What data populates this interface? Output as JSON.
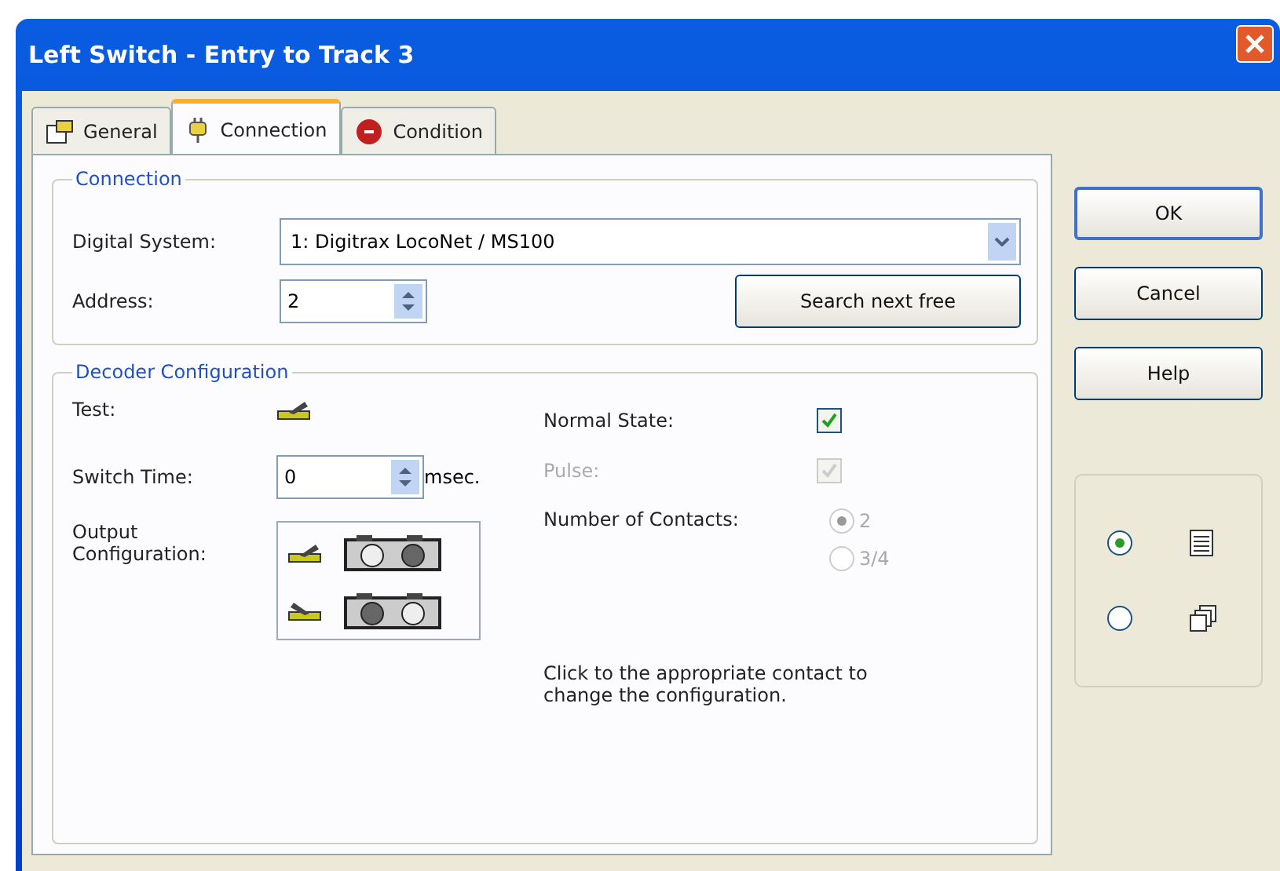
{
  "window": {
    "title": "Left Switch - Entry to Track 3"
  },
  "tabs": [
    {
      "label": "General",
      "selected": false
    },
    {
      "label": "Connection",
      "selected": true
    },
    {
      "label": "Condition",
      "selected": false
    }
  ],
  "connection": {
    "title": "Connection",
    "digital_system": {
      "label": "Digital System:",
      "value": "1: Digitrax LocoNet / MS100"
    },
    "address": {
      "label": "Address:",
      "value": "2"
    },
    "search_button": "Search next free"
  },
  "decoder": {
    "title": "Decoder Configuration",
    "test": {
      "label": "Test:"
    },
    "switch_time": {
      "label": "Switch Time:",
      "value": "0",
      "unit": "msec."
    },
    "output_configuration": {
      "label": "Output Configuration:"
    },
    "normal_state": {
      "label": "Normal State:",
      "checked": true,
      "disabled": false
    },
    "pulse": {
      "label": "Pulse:",
      "checked": true,
      "disabled": true
    },
    "contacts": {
      "label": "Number of Contacts:",
      "options": [
        {
          "label": "2",
          "selected": true,
          "disabled": true
        },
        {
          "label": "3/4",
          "selected": false,
          "disabled": true
        }
      ]
    },
    "hint": "Click to the appropriate contact to change the configuration."
  },
  "buttons": [
    "OK",
    "Cancel",
    "Help"
  ],
  "view_options": [
    {
      "selected": true
    },
    {
      "selected": false
    }
  ]
}
